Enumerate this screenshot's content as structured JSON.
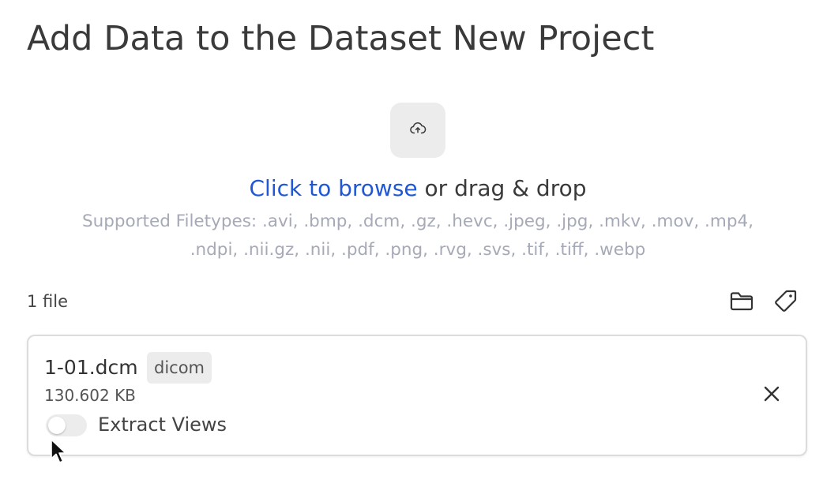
{
  "page": {
    "title": "Add Data to the Dataset New Project"
  },
  "upload": {
    "icon": "cloud-upload-icon",
    "browse_link": "Click to browse",
    "browse_suffix": " or drag & drop",
    "filetypes_line1": "Supported Filetypes: .avi, .bmp, .dcm, .gz, .hevc, .jpeg, .jpg, .mkv, .mov, .mp4,",
    "filetypes_line2": ".ndpi, .nii.gz, .nii, .pdf, .png, .rvg, .svs, .tif, .tiff, .webp"
  },
  "files": {
    "count_label": "1 file",
    "toolbar_icons": [
      "folder-icon",
      "tag-icon"
    ],
    "items": [
      {
        "name": "1-01.dcm",
        "type_badge": "dicom",
        "size": "130.602 KB",
        "extract_views_label": "Extract Views",
        "extract_views_enabled": false
      }
    ]
  },
  "colors": {
    "link": "#1f57d6",
    "muted_text": "#a6a9b6",
    "chip_bg": "#ececed"
  }
}
